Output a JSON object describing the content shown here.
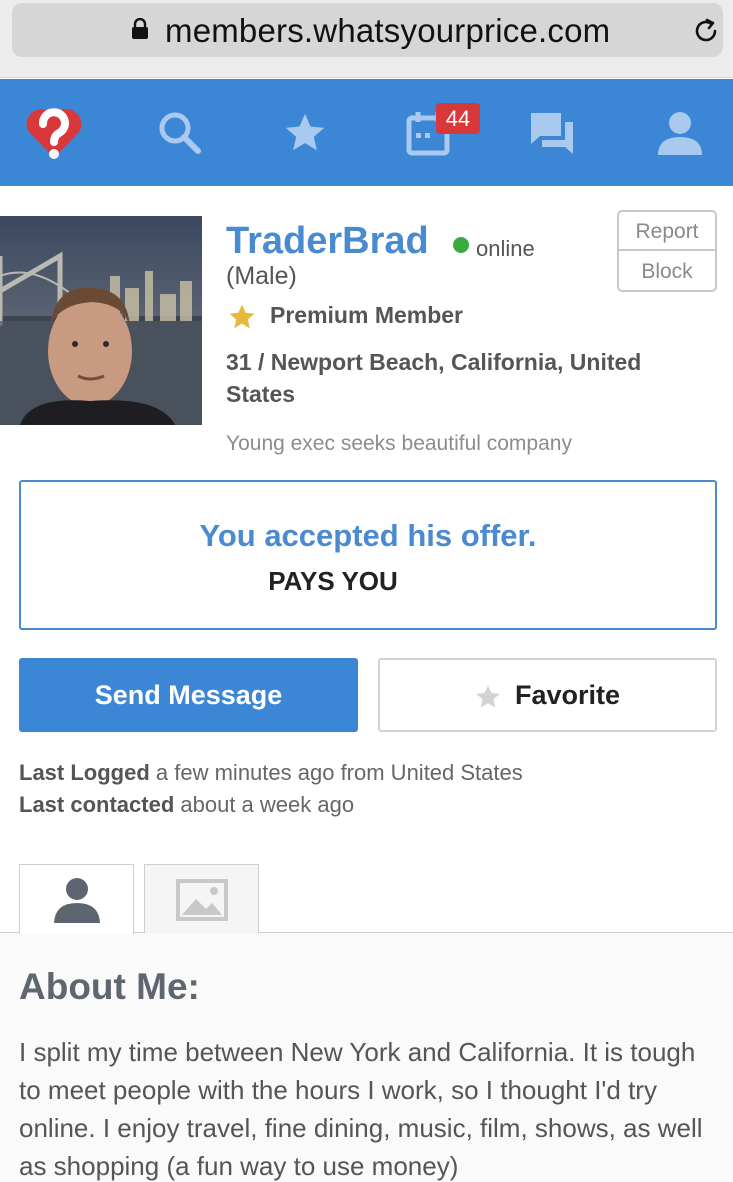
{
  "browser": {
    "url": "members.whatsyourprice.com"
  },
  "nav": {
    "items": [
      "logo",
      "search",
      "favorites",
      "calendar",
      "messages",
      "profile"
    ],
    "calendar_badge": "44"
  },
  "profile": {
    "username": "TraderBrad",
    "status": "online",
    "gender": "(Male)",
    "membership": "Premium Member",
    "location": "31 / Newport Beach, California, United States",
    "tagline": "Young exec seeks beautiful company",
    "report_label": "Report",
    "block_label": "Block"
  },
  "offer": {
    "title": "You accepted his offer.",
    "subtitle": "PAYS YOU"
  },
  "actions": {
    "send_message": "Send Message",
    "favorite": "Favorite"
  },
  "activity": {
    "last_logged_label": "Last Logged",
    "last_logged_value": "a few minutes ago from United States",
    "last_contacted_label": "Last contacted",
    "last_contacted_value": "about a week ago"
  },
  "about": {
    "title": "About Me:",
    "text": "I split my time between New York and California. It is tough to meet people with the hours I work, so I thought I'd try online. I enjoy travel, fine dining, music, film, shows, as well as shopping (a fun way to use money)"
  },
  "colors": {
    "brand_blue": "#3c86d6",
    "badge_red": "#d9383a",
    "online_green": "#3cab3f",
    "star_gold": "#e8b83a"
  }
}
